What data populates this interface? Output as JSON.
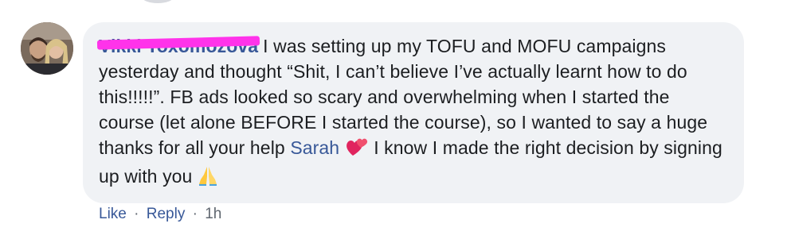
{
  "comment": {
    "author_name": "Vikki Toxomozova",
    "text_part_1": "I was setting up my TOFU and MOFU campaigns yesterday and thought “Shit, I can’t believe I’ve actually learnt how to do this!!!!!”. FB ads looked so scary and overwhelming when I started the course (let alone BEFORE I started the course), so I wanted to say a huge thanks for all your help",
    "mention": "Sarah",
    "text_part_2": "I know I made the right decision by signing up with you",
    "emoji_1": "two-hearts-icon",
    "emoji_2": "folded-hands-icon"
  },
  "actions": {
    "like_label": "Like",
    "reply_label": "Reply",
    "separator": "·",
    "timestamp": "1h"
  },
  "colors": {
    "link": "#385898",
    "bubble": "#f0f2f5",
    "text": "#1c1e21",
    "meta": "#606770",
    "redaction": "#ff33ea"
  }
}
